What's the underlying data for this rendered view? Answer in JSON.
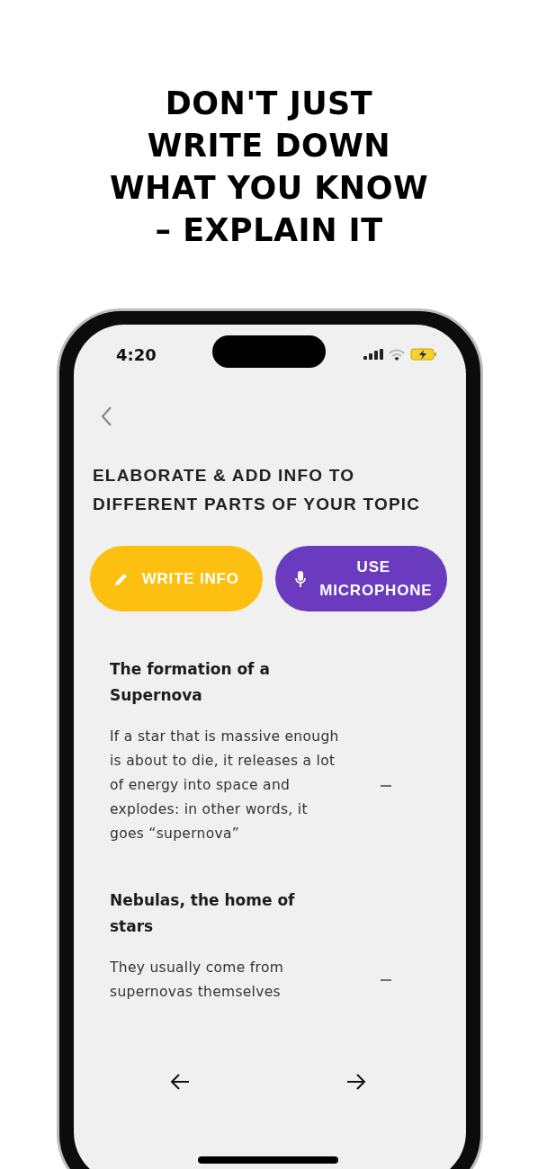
{
  "headline": [
    "DON'T JUST",
    "WRITE DOWN",
    "WHAT YOU KNOW",
    "– EXPLAIN IT"
  ],
  "status_bar": {
    "time": "4:20"
  },
  "heading": "ELABORATE & ADD INFO TO DIFFERENT PARTS OF YOUR TOPIC",
  "buttons": [
    {
      "kind": "write",
      "label": "WRITE INFO"
    },
    {
      "kind": "microphone",
      "label": "USE MICROPHONE"
    }
  ],
  "topics": [
    {
      "title": "The formation of a Supernova",
      "text": "If a star that is massive enough is about to die, it releases a lot of energy into space and explodes: in other words, it goes “supernova”",
      "expanded": true
    },
    {
      "title": "Nebulas, the home of stars",
      "text": "They usually come from supernovas themselves",
      "expanded": true
    }
  ]
}
